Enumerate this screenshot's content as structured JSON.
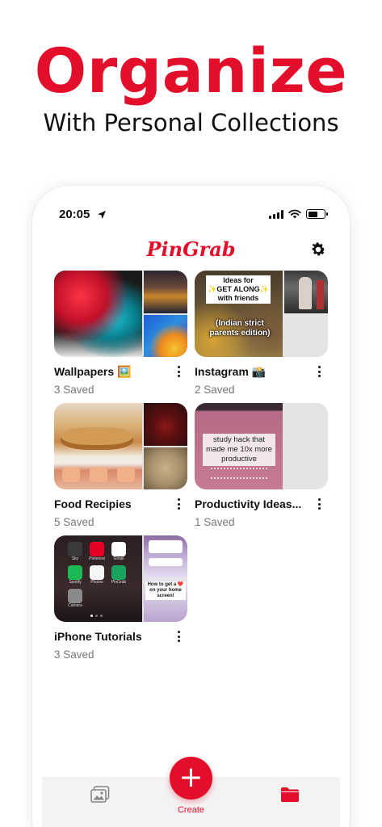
{
  "promo": {
    "headline": "Organize",
    "subheadline": "With Personal Collections"
  },
  "status_bar": {
    "time": "20:05",
    "location_icon": "location-arrow-icon",
    "signal_icon": "cellular-signal-icon",
    "wifi_icon": "wifi-icon",
    "battery_icon": "battery-icon"
  },
  "header": {
    "app_name": "PinGrab",
    "settings_icon": "gear-icon"
  },
  "collections": [
    {
      "name": "Wallpapers 🖼️",
      "count": "3 Saved"
    },
    {
      "name": "Instagram 📸",
      "count": "2 Saved"
    },
    {
      "name": "Food Recipies",
      "count": "5 Saved"
    },
    {
      "name": "Productivity Ideas...",
      "count": "1 Saved"
    },
    {
      "name": "iPhone Tutorials",
      "count": "3 Saved"
    }
  ],
  "thumb_text": {
    "instagram_line1": "Ideas for",
    "instagram_line2": "✨GET ALONG✨",
    "instagram_line3": "with friends",
    "instagram_line4": "(Indian strict",
    "instagram_line5": "parents edition)",
    "productivity_line1": "study hack that",
    "productivity_line2": "made me 10x more",
    "productivity_line3": "productive",
    "iphone_apps": [
      "Sky",
      "Pinterest",
      "Gmail",
      "Spotify",
      "Photos",
      "PinGrab",
      "Camera"
    ],
    "iphone_side": "How to get a ❤️ on your home screen!"
  },
  "tab_bar": {
    "gallery_icon": "image-gallery-icon",
    "create_label": "Create",
    "create_icon": "plus-icon",
    "folder_icon": "folder-icon"
  },
  "colors": {
    "accent": "#e30f2a",
    "text": "#111111",
    "muted": "#777777",
    "tab_bg": "#f3f3f3"
  }
}
